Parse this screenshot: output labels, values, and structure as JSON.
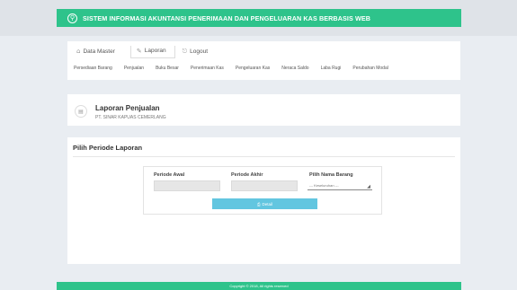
{
  "header": {
    "logo_glyph": "⚲",
    "title": "SISTEM INFORMASI AKUNTANSI PENERIMAAN DAN PENGELUARAN KAS BERBASIS WEB"
  },
  "tabs": [
    {
      "label": "Data Master",
      "icon": "home-icon",
      "glyph": "⌂"
    },
    {
      "label": "Laporan",
      "icon": "report-icon",
      "glyph": "✎"
    },
    {
      "label": "Logout",
      "icon": "logout-icon",
      "glyph": "⎋"
    }
  ],
  "active_tab": "Laporan",
  "subnav": [
    "Persediaan Barang",
    "Penjualan",
    "Buku Besar",
    "Penerimaan Kas",
    "Pengeluaran Kas",
    "Neraca Saldo",
    "Laba Rugi",
    "Perubahan Modal"
  ],
  "report": {
    "icon_glyph": "▤",
    "title": "Laporan Penjualan",
    "subtitle": "PT. SINAR KAPUAS CEMERLANG"
  },
  "form": {
    "title": "Pilih Periode Laporan",
    "periode_awal_label": "Periode Awal",
    "periode_awal_value": "",
    "periode_akhir_label": "Periode Akhir",
    "periode_akhir_value": "",
    "barang_label": "Pilih Nama Barang",
    "barang_selected": "--- Keseluruhan ---",
    "caret_glyph": "◢",
    "button_glyph": "⎙",
    "button_label": "Detail"
  },
  "footer": {
    "text": "Copyright © 2018, All rights reserved"
  },
  "colors": {
    "accent": "#2ec38b",
    "button": "#62c6e0",
    "background": "#e9edf2"
  }
}
